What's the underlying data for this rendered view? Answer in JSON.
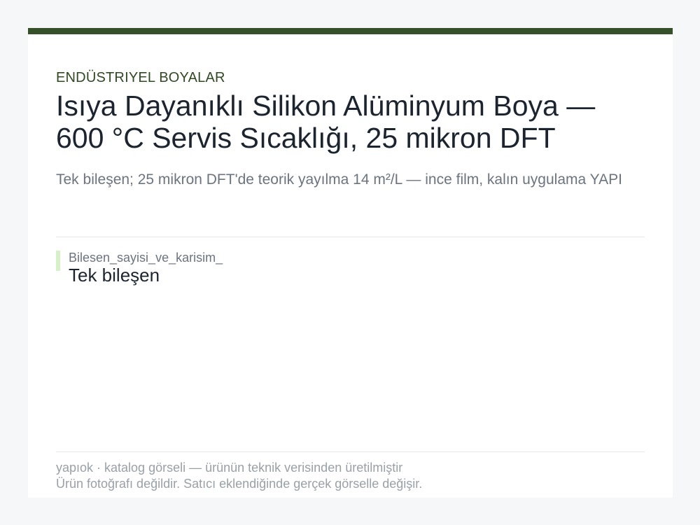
{
  "category": "ENDÜSTRIYEL BOYALAR",
  "title": "Isıya Dayanıklı Silikon Alüminyum Boya — 600 °C Servis Sıcaklığı, 25 mikron DFT",
  "subtitle": "Tek bileşen; 25 mikron DFT'de teorik yayılma 14 m²/L — ince film, kalın uygulama YAPI",
  "spec": {
    "key": "Bilesen_sayisi_ve_karisim_",
    "value": "Tek bileşen"
  },
  "footer": {
    "line1": "yapıok · katalog görseli — ürünün teknik verisinden üretilmiştir",
    "line2": "Ürün fotoğrafı değildir. Satıcı eklendiğinde gerçek görselle değişir."
  },
  "colors": {
    "accent": "#36502a",
    "spec_bar": "#d6f0c8",
    "background": "#f6f7f9",
    "card": "#ffffff"
  }
}
